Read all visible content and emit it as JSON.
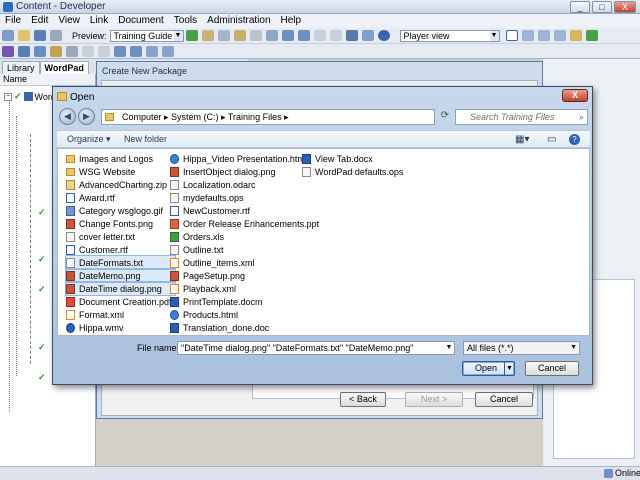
{
  "app": {
    "title": "Content - Developer",
    "window_controls": [
      "_",
      "□",
      "X"
    ]
  },
  "menu": [
    "File",
    "Edit",
    "View",
    "Link",
    "Document",
    "Tools",
    "Administration",
    "Help"
  ],
  "toolbar": {
    "preview_label": "Preview:",
    "preview_value": "Training Guide",
    "player_value": "Player view"
  },
  "left_tabs": [
    "Library",
    "WordPad"
  ],
  "tree": {
    "header": "Name",
    "root_label": "Word"
  },
  "package_dialog": {
    "title": "Create New Package",
    "back_label": "< Back",
    "next_label": "Next >",
    "cancel_label": "Cancel"
  },
  "open_dialog": {
    "title": "Open",
    "close_label": "X",
    "breadcrumb": "Computer ▸ System (C:) ▸ Training Files ▸",
    "search_placeholder": "Search Training Files",
    "organize_label": "Organize ▾",
    "new_folder_label": "New folder",
    "files": [
      [
        {
          "name": "Images and Logos",
          "type": "folder",
          "selected": false
        },
        {
          "name": "WSG Website",
          "type": "folder",
          "selected": false
        },
        {
          "name": "AdvancedCharting.zip",
          "type": "zip",
          "selected": false
        },
        {
          "name": "Award.rtf",
          "type": "rtf",
          "selected": false
        },
        {
          "name": "Category wsglogo.gif",
          "type": "gif",
          "selected": false
        },
        {
          "name": "Change Fonts.png",
          "type": "png",
          "selected": false
        },
        {
          "name": "cover letter.txt",
          "type": "txt",
          "selected": false
        },
        {
          "name": "Customer.rtf",
          "type": "rtf",
          "selected": false
        },
        {
          "name": "DateFormats.txt",
          "type": "txt",
          "selected": true
        },
        {
          "name": "DateMemo.png",
          "type": "png",
          "selected": true
        },
        {
          "name": "DateTime dialog.png",
          "type": "png",
          "selected": true
        },
        {
          "name": "Document Creation.pdf",
          "type": "pdf",
          "selected": false
        },
        {
          "name": "Format.xml",
          "type": "xml",
          "selected": false
        },
        {
          "name": "Hippa.wmv",
          "type": "wmv",
          "selected": false
        }
      ],
      [
        {
          "name": "Hippa_Video Presentation.html",
          "type": "web",
          "selected": false
        },
        {
          "name": "InsertObject dialog.png",
          "type": "png",
          "selected": false
        },
        {
          "name": "Localization.odarc",
          "type": "txt",
          "selected": false
        },
        {
          "name": "mydefaults.ops",
          "type": "txt",
          "selected": false
        },
        {
          "name": "NewCustomer.rtf",
          "type": "rtf",
          "selected": false
        },
        {
          "name": "Order Release Enhancements.ppt",
          "type": "ppt",
          "selected": false
        },
        {
          "name": "Orders.xls",
          "type": "xls",
          "selected": false
        },
        {
          "name": "Outline.txt",
          "type": "txt",
          "selected": false
        },
        {
          "name": "Outline_items.xml",
          "type": "xml",
          "selected": false
        },
        {
          "name": "PageSetup.png",
          "type": "png",
          "selected": false
        },
        {
          "name": "Playback.xml",
          "type": "xml",
          "selected": false
        },
        {
          "name": "PrintTemplate.docm",
          "type": "doc",
          "selected": false
        },
        {
          "name": "Products.html",
          "type": "web",
          "selected": false
        },
        {
          "name": "Translation_done.doc",
          "type": "doc",
          "selected": false
        }
      ],
      [
        {
          "name": "View Tab.docx",
          "type": "doc",
          "selected": false
        },
        {
          "name": "WordPad defaults.ops",
          "type": "txt",
          "selected": false
        }
      ]
    ],
    "filename_label": "File name:",
    "filename_value": "\"DateTime dialog.png\" \"DateFormats.txt\" \"DateMemo.png\"",
    "filetype_value": "All files (*.*)",
    "open_label": "Open",
    "cancel_label": "Cancel"
  },
  "status": {
    "online_label": "Online"
  },
  "colors": {
    "selection": "#dce9f8",
    "dialog_frame": "#a9c1de"
  }
}
